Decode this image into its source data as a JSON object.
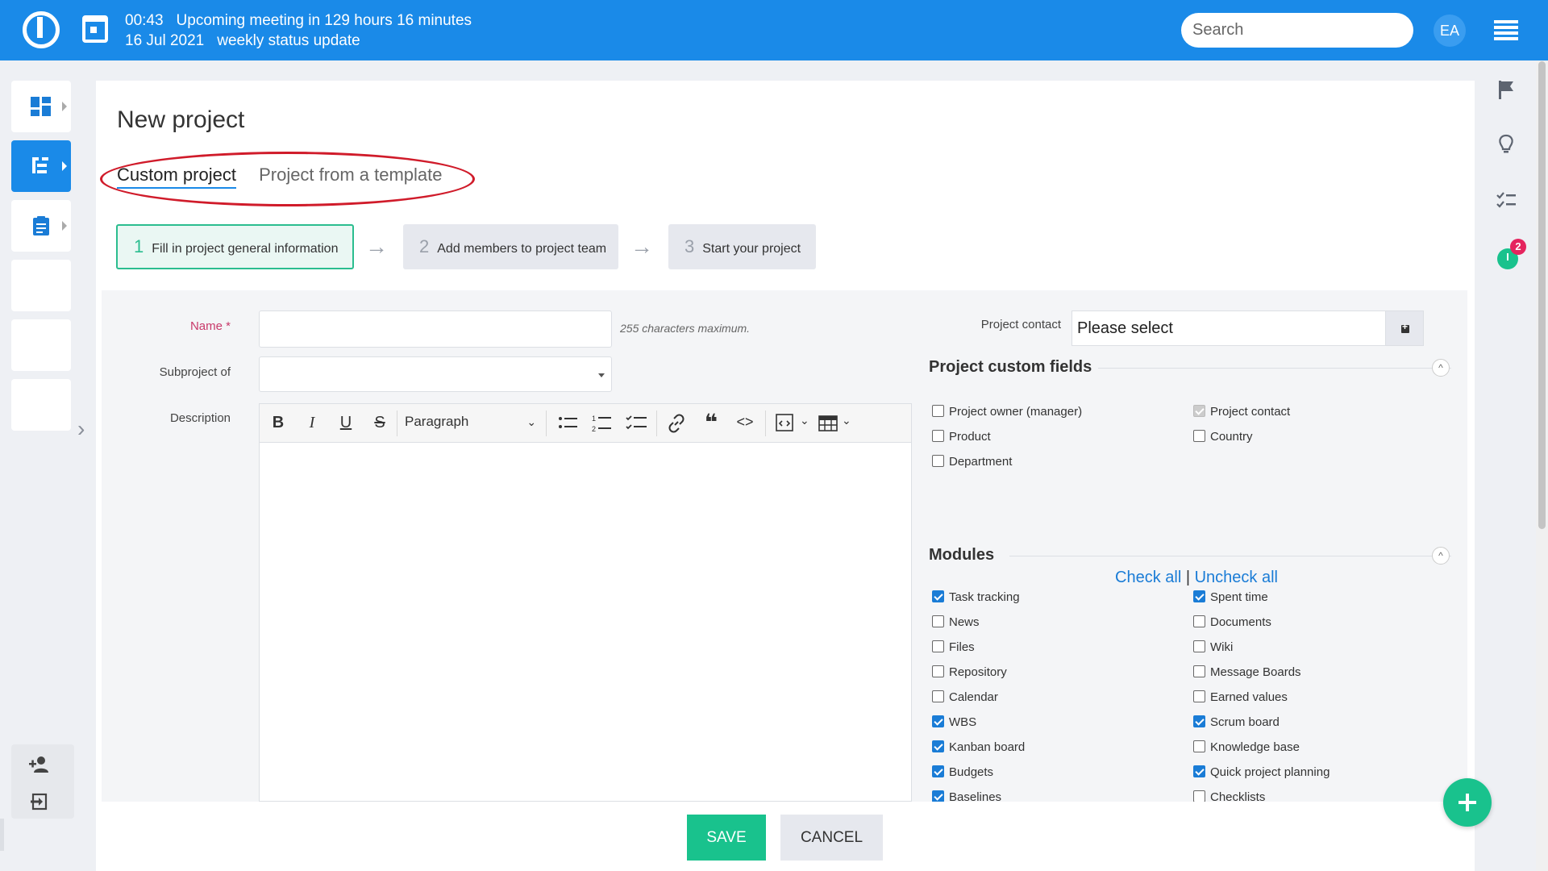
{
  "topbar": {
    "time": "00:43",
    "meeting_text": "Upcoming meeting in 129 hours 16 minutes",
    "date": "16 Jul 2021",
    "meeting_name": "weekly status update",
    "search_placeholder": "Search",
    "avatar_initials": "EA",
    "brand_color": "#1a8ae8"
  },
  "sidebar": {
    "items": [
      {
        "name": "dashboard",
        "icon": "dashboard-icon",
        "active": false
      },
      {
        "name": "projects",
        "icon": "project-tree-icon",
        "active": true
      },
      {
        "name": "tasks",
        "icon": "clipboard-icon",
        "active": false
      }
    ],
    "bottom_icons": [
      "add-user-icon",
      "logout-icon"
    ]
  },
  "right_sidebar": {
    "icons": [
      "flag-icon",
      "lightbulb-icon",
      "checklist-icon",
      "timer-icon"
    ],
    "timer_badge": "2"
  },
  "page": {
    "title": "New project",
    "tabs": [
      {
        "label": "Custom project",
        "active": true
      },
      {
        "label": "Project from a template",
        "active": false
      }
    ],
    "steps": [
      {
        "num": "1",
        "label": "Fill in project general information",
        "active": true
      },
      {
        "num": "2",
        "label": "Add members to project team",
        "active": false
      },
      {
        "num": "3",
        "label": "Start your project",
        "active": false
      }
    ]
  },
  "form": {
    "name_label": "Name *",
    "name_value": "",
    "name_hint": "255 characters maximum.",
    "subproject_label": "Subproject of",
    "subproject_value": "",
    "description_label": "Description",
    "paragraph_select": "Paragraph",
    "project_contact_label": "Project contact",
    "project_contact_value": "Please select"
  },
  "custom_fields": {
    "title": "Project custom fields",
    "left": [
      {
        "label": "Project owner (manager)",
        "checked": false
      },
      {
        "label": "Product",
        "checked": false
      },
      {
        "label": "Department",
        "checked": false
      }
    ],
    "right": [
      {
        "label": "Project contact",
        "checked": true,
        "disabled": true
      },
      {
        "label": "Country",
        "checked": false
      }
    ],
    "check_all": "Check all",
    "separator": "|",
    "uncheck_all": "Uncheck all"
  },
  "modules": {
    "title": "Modules",
    "left": [
      {
        "label": "Task tracking",
        "checked": true
      },
      {
        "label": "News",
        "checked": false
      },
      {
        "label": "Files",
        "checked": false
      },
      {
        "label": "Repository",
        "checked": false
      },
      {
        "label": "Calendar",
        "checked": false
      },
      {
        "label": "WBS",
        "checked": true
      },
      {
        "label": "Kanban board",
        "checked": true
      },
      {
        "label": "Budgets",
        "checked": true
      },
      {
        "label": "Baselines",
        "checked": true
      }
    ],
    "right": [
      {
        "label": "Spent time",
        "checked": true
      },
      {
        "label": "Documents",
        "checked": false
      },
      {
        "label": "Wiki",
        "checked": false
      },
      {
        "label": "Message Boards",
        "checked": false
      },
      {
        "label": "Earned values",
        "checked": false
      },
      {
        "label": "Scrum board",
        "checked": true
      },
      {
        "label": "Knowledge base",
        "checked": false
      },
      {
        "label": "Quick project planning",
        "checked": true
      },
      {
        "label": "Checklists",
        "checked": false
      }
    ]
  },
  "actions": {
    "save": "SAVE",
    "cancel": "CANCEL",
    "save_color": "#19c28d"
  }
}
